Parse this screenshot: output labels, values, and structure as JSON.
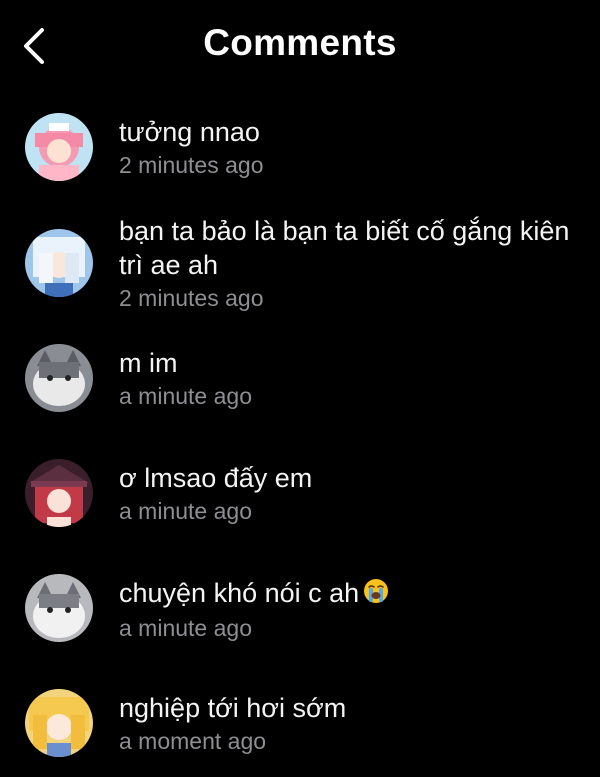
{
  "header": {
    "title": "Comments",
    "back_icon": "chevron-left-icon"
  },
  "comments": [
    {
      "text": "tưởng nnao",
      "time": "2 minutes ago",
      "avatar": "anime-girl-pink-avatar"
    },
    {
      "text": "bạn ta bảo là bạn ta biết cố gắng kiên trì ae ah",
      "time": "2 minutes ago",
      "avatar": "anime-girl-white-hair-avatar"
    },
    {
      "text": "m im",
      "time": "a minute ago",
      "avatar": "cat-avatar"
    },
    {
      "text": "ơ lmsao đấy em",
      "time": "a minute ago",
      "avatar": "anime-girl-red-hat-avatar"
    },
    {
      "text": "chuyện khó nói c ah",
      "time": "a minute ago",
      "avatar": "cat-avatar",
      "emoji": "loudly-crying-face-icon"
    },
    {
      "text": "nghiệp tới hơi sớm",
      "time": "a moment ago",
      "avatar": "anime-girl-blonde-avatar"
    }
  ],
  "colors": {
    "background": "#000000",
    "text": "#f4f4f4",
    "timestamp": "#8e8e93"
  }
}
